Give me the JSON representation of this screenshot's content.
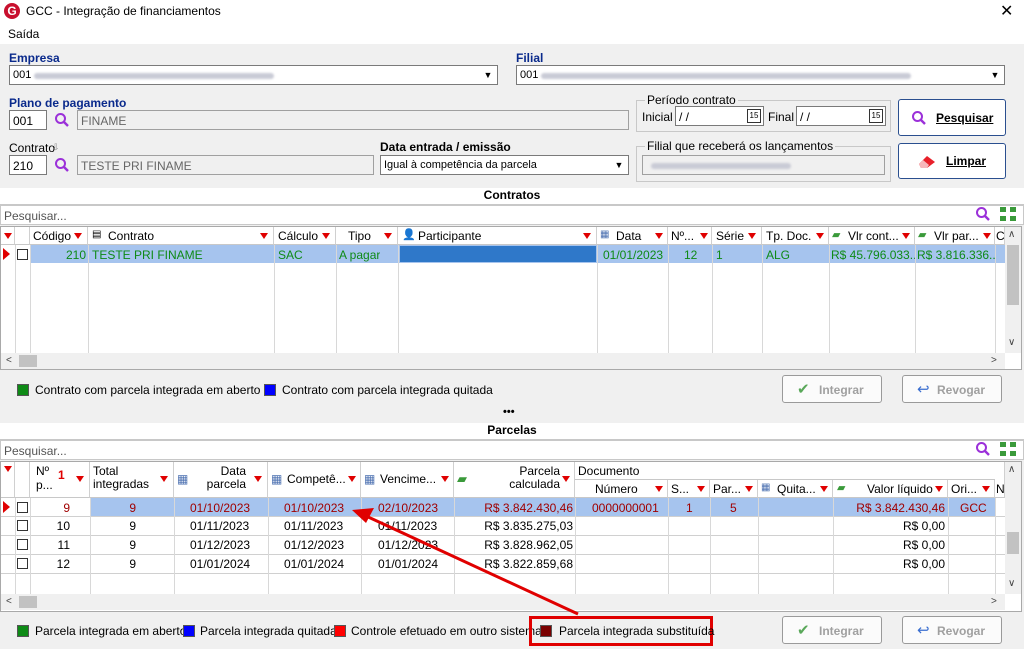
{
  "window": {
    "title": "GCC - Integração de financiamentos",
    "close_glyph": "✕",
    "logo_letter": "G"
  },
  "menu": {
    "items": [
      "Saída"
    ]
  },
  "empresa": {
    "label": "Empresa",
    "code": "001"
  },
  "filial": {
    "label": "Filial",
    "code": "001"
  },
  "plano": {
    "label": "Plano de pagamento",
    "code": "001",
    "name": "FINAME"
  },
  "periodo": {
    "label": "Período contrato",
    "inicial_label": "Inicial",
    "inicial_value": " / /",
    "final_label": "Final",
    "final_value": " / /",
    "cal_glyph": "15"
  },
  "buttons": {
    "pesquisar": "Pesquisar",
    "limpar": "Limpar",
    "integrar": "Integrar",
    "revogar": "Revogar"
  },
  "contrato": {
    "label": "Contrato",
    "code": "210",
    "name": "TESTE PRI FINAME"
  },
  "data_entrada": {
    "label": "Data entrada / emissão",
    "value": "Igual à competência da parcela"
  },
  "filial_lanc": {
    "label": "Filial que receberá os lançamentos"
  },
  "contratos_section": {
    "title": "Contratos",
    "search_placeholder": "Pesquisar..."
  },
  "contratos_table": {
    "headers": [
      "Código",
      "Contrato",
      "Cálculo",
      "Tipo",
      "Participante",
      "Data",
      "Nº...",
      "Série",
      "Tp. Doc.",
      "Vlr cont...",
      "Vlr par...",
      "C"
    ],
    "rows": [
      {
        "codigo": "210",
        "contrato": "TESTE PRI FINAME",
        "calculo": "SAC",
        "tipo": "A pagar",
        "participante": "",
        "data": "01/01/2023",
        "num": "12",
        "serie": "1",
        "tpdoc": "ALG",
        "vlr_cont": "R$ 45.796.033...",
        "vlr_par": "R$ 3.816.336..."
      }
    ]
  },
  "legend_contratos": [
    {
      "label": "Contrato com parcela integrada em aberto",
      "color": "#0e8a16"
    },
    {
      "label": "Contrato com parcela integrada quitada",
      "color": "#0000ff"
    }
  ],
  "parcelas_section": {
    "title": "Parcelas",
    "search_placeholder": "Pesquisar...",
    "divider": "•••"
  },
  "parcelas_table": {
    "headers": {
      "num": "Nº p...",
      "sort": "1",
      "total": "Total integradas",
      "data": "Data parcela",
      "compet": "Competê...",
      "venc": "Vencime...",
      "calc": "Parcela calculada",
      "documento": "Documento",
      "numero": "Número",
      "s": "S...",
      "par": "Par...",
      "quita": "Quita...",
      "liquido": "Valor líquido",
      "ori": "Ori...",
      "n": "N"
    },
    "rows": [
      {
        "num": "9",
        "total": "9",
        "data": "01/10/2023",
        "compet": "01/10/2023",
        "venc": "02/10/2023",
        "calc": "R$ 3.842.430,46",
        "numero": "0000000001",
        "s": "1",
        "par": "5",
        "liquido": "R$ 3.842.430,46",
        "ori": "GCC"
      },
      {
        "num": "10",
        "total": "9",
        "data": "01/11/2023",
        "compet": "01/11/2023",
        "venc": "01/11/2023",
        "calc": "R$ 3.835.275,03",
        "numero": "",
        "s": "",
        "par": "",
        "liquido": "R$ 0,00",
        "ori": ""
      },
      {
        "num": "11",
        "total": "9",
        "data": "01/12/2023",
        "compet": "01/12/2023",
        "venc": "01/12/2023",
        "calc": "R$ 3.828.962,05",
        "numero": "",
        "s": "",
        "par": "",
        "liquido": "R$ 0,00",
        "ori": ""
      },
      {
        "num": "12",
        "total": "9",
        "data": "01/01/2024",
        "compet": "01/01/2024",
        "venc": "01/01/2024",
        "calc": "R$ 3.822.859,68",
        "numero": "",
        "s": "",
        "par": "",
        "liquido": "R$ 0,00",
        "ori": ""
      }
    ]
  },
  "legend_parcelas": [
    {
      "label": "Parcela integrada em aberto",
      "color": "#0e8a16"
    },
    {
      "label": "Parcela integrada quitada",
      "color": "#0000ff"
    },
    {
      "label": "Controle efetuado em outro sistema",
      "color": "#ff0000"
    },
    {
      "label": "Parcela integrada substituída",
      "color": "#7a0000"
    }
  ],
  "colors": {
    "selected_row": "#a6c4ee",
    "green_text": "#0e8a16",
    "red_text": "#a00000",
    "annotation": "#e00000"
  }
}
